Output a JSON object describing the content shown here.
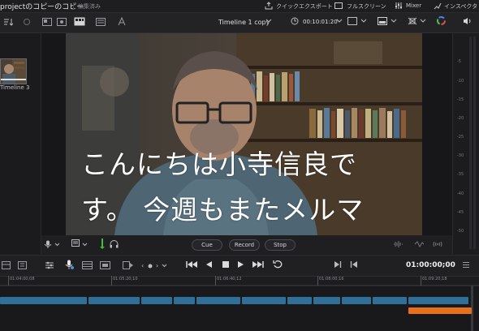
{
  "topbar": {
    "project_title": "projectのコピーのコピー",
    "status": "編集済み",
    "quick_export": "クイックエクスポート",
    "fullscreen": "フルスクリーン",
    "mixer": "Mixer",
    "inspector": "インスペクタ"
  },
  "viewer": {
    "timeline_name": "Timeline 1 copy",
    "timecode": "00:10:01:20",
    "subtitle_line1": "こんにちは小寺信良で",
    "subtitle_line2": "す。 今週もまたメルマ"
  },
  "media_pool": {
    "items": [
      {
        "label": "Timeline 3"
      }
    ]
  },
  "record_controls": {
    "cue": "Cue",
    "record": "Record",
    "stop": "Stop"
  },
  "meter": {
    "ticks": [
      "-5",
      "-10",
      "-15",
      "-20",
      "-25",
      "-30",
      "-35",
      "-40",
      "-45",
      "-50"
    ]
  },
  "timeline": {
    "current_timecode": "01:00:00;00",
    "ruler_labels": [
      "01:04:00;08",
      "01:05:20;10",
      "01:06:40;12",
      "01:08:00;16",
      "01:09:20;18"
    ]
  },
  "colors": {
    "clip_blue": "#2f6f98",
    "clip_orange": "#e8701a",
    "background": "#1c1c1f"
  }
}
